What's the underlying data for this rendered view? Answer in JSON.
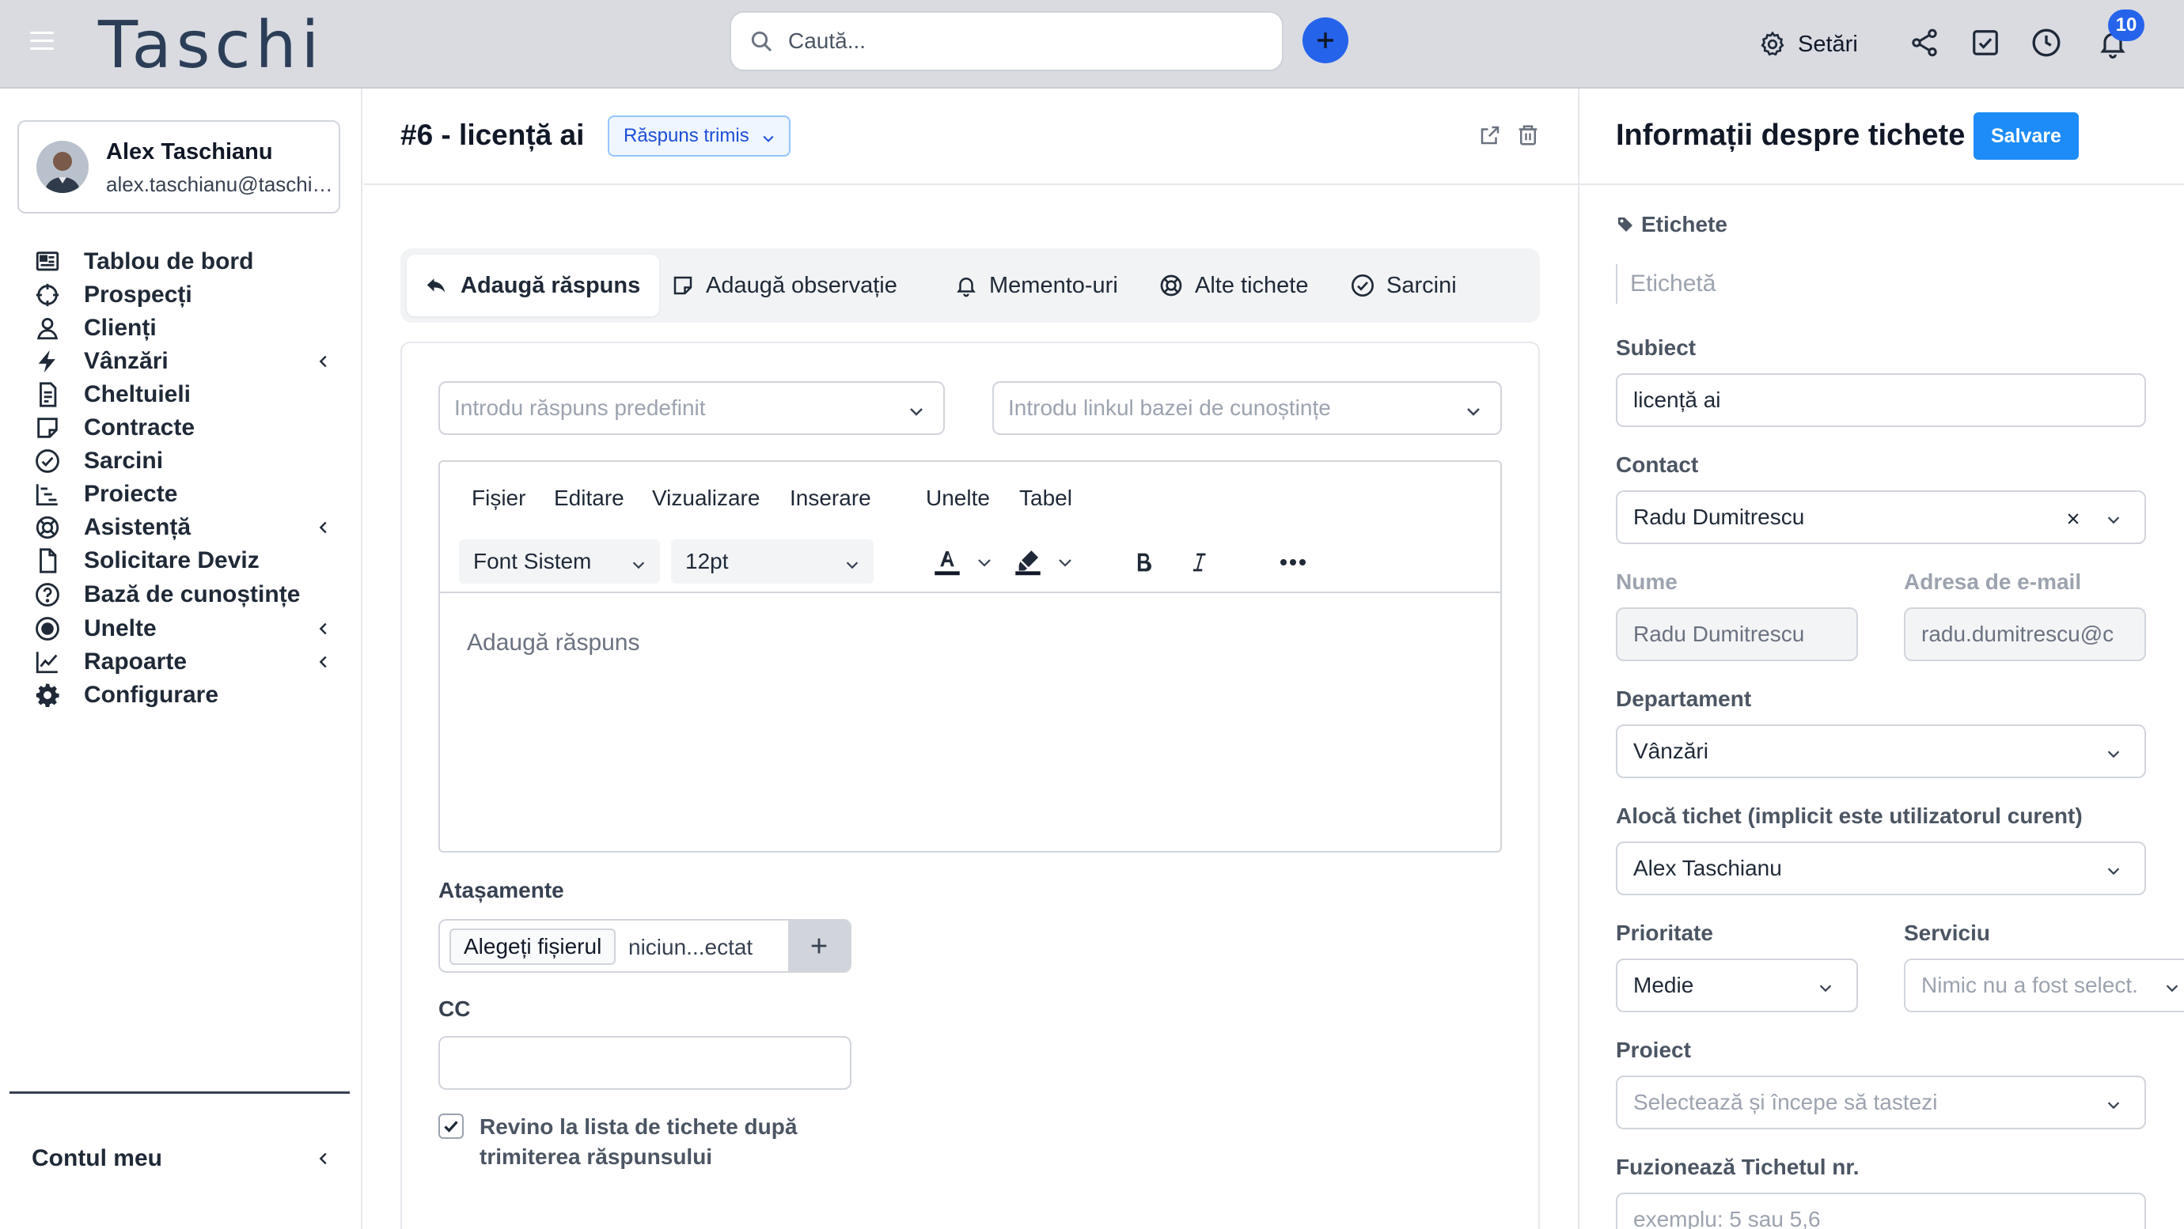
{
  "topbar": {
    "logo": "Taschi",
    "search_placeholder": "Caută...",
    "settings_label": "Setări",
    "notifications_count": "10"
  },
  "user": {
    "name": "Alex Taschianu",
    "email": "alex.taschianu@taschi.ro"
  },
  "sidebar": {
    "items": [
      {
        "label": "Tablou de bord",
        "icon": "dashboard-icon",
        "has_submenu": false
      },
      {
        "label": "Prospecți",
        "icon": "crosshair-icon",
        "has_submenu": false
      },
      {
        "label": "Clienți",
        "icon": "user-icon",
        "has_submenu": false
      },
      {
        "label": "Vânzări",
        "icon": "bolt-icon",
        "has_submenu": true
      },
      {
        "label": "Cheltuieli",
        "icon": "receipt-icon",
        "has_submenu": false
      },
      {
        "label": "Contracte",
        "icon": "contract-icon",
        "has_submenu": false
      },
      {
        "label": "Sarcini",
        "icon": "check-circle-icon",
        "has_submenu": false
      },
      {
        "label": "Proiecte",
        "icon": "gantt-icon",
        "has_submenu": false
      },
      {
        "label": "Asistență",
        "icon": "lifebuoy-icon",
        "has_submenu": true
      },
      {
        "label": "Solicitare Deviz",
        "icon": "document-icon",
        "has_submenu": false
      },
      {
        "label": "Bază de cunoștințe",
        "icon": "question-icon",
        "has_submenu": false
      },
      {
        "label": "Unelte",
        "icon": "record-icon",
        "has_submenu": true
      },
      {
        "label": "Rapoarte",
        "icon": "line-chart-icon",
        "has_submenu": true
      },
      {
        "label": "Configurare",
        "icon": "cog-icon",
        "has_submenu": false
      }
    ],
    "account_label": "Contul meu"
  },
  "ticket": {
    "title": "#6 - licență ai",
    "status": "Răspuns trimis"
  },
  "tabs": [
    {
      "label": "Adaugă răspuns",
      "icon": "reply-icon",
      "active": true
    },
    {
      "label": "Adaugă observație",
      "icon": "note-icon",
      "active": false
    },
    {
      "label": "Memento-uri",
      "icon": "bell-icon",
      "active": false
    },
    {
      "label": "Alte tichete",
      "icon": "lifebuoy-icon",
      "active": false
    },
    {
      "label": "Sarcini",
      "icon": "check-circle-icon",
      "active": false
    }
  ],
  "reply": {
    "predefined_placeholder": "Introdu răspuns predefinit",
    "kb_placeholder": "Introdu linkul bazei de cunoștințe",
    "menus": [
      "Fișier",
      "Editare",
      "Vizualizare",
      "Inserare",
      "Unelte",
      "Tabel"
    ],
    "font_family": "Font Sistem",
    "font_size": "12pt",
    "editor_placeholder": "Adaugă răspuns",
    "attachments_label": "Atașamente",
    "file_button": "Alegeți fișierul",
    "file_status": "niciun...ectat",
    "cc_label": "CC",
    "return_checkbox_label": "Revino la lista de tichete după trimiterea răspunsului",
    "return_checked": true
  },
  "panel": {
    "title": "Informații despre tichete",
    "save_label": "Salvare",
    "tags_label": "Etichete",
    "tags_placeholder": "Etichetă",
    "subject_label": "Subiect",
    "subject_value": "licență ai",
    "contact_label": "Contact",
    "contact_value": "Radu Dumitrescu",
    "name_label": "Nume",
    "name_value": "Radu Dumitrescu",
    "email_label": "Adresa de e-mail",
    "email_value": "radu.dumitrescu@c",
    "department_label": "Departament",
    "department_value": "Vânzări",
    "assign_label": "Alocă tichet (implicit este utilizatorul curent)",
    "assign_value": "Alex Taschianu",
    "priority_label": "Prioritate",
    "priority_value": "Medie",
    "service_label": "Serviciu",
    "service_placeholder": "Nimic nu a fost select.",
    "project_label": "Proiect",
    "project_placeholder": "Selectează și începe să tastezi",
    "merge_label": "Fuzionează Tichetul nr.",
    "merge_placeholder": "exemplu: 5 sau 5,6"
  },
  "colors": {
    "accent": "#2563eb",
    "save_button": "#1d8cf8",
    "topbar": "#d9dbe1"
  }
}
